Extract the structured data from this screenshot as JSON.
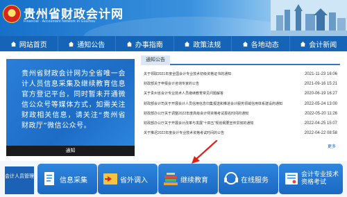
{
  "header": {
    "title": "贵州省财政会计网",
    "subtitle": "Financial · Accountant Network In GuiZhou"
  },
  "nav": [
    {
      "label": "网站首页",
      "icon": "home-icon"
    },
    {
      "label": "通知公告",
      "icon": "home-icon"
    },
    {
      "label": "办事指南",
      "icon": "home-icon"
    },
    {
      "label": "政策法规",
      "icon": "home-icon"
    },
    {
      "label": "各地动态",
      "icon": "home-icon"
    },
    {
      "label": "会计新闻",
      "icon": "home-icon"
    }
  ],
  "banner": {
    "text": "贵州省财政会计网为全省唯一会计人员信息采集及继续教育信息官方登记平台，同时暂未开通微信公众号等媒体方式，如需关注财政相关信息，请关注“贵州省财政厅”微信公众号。",
    "caption": "通知"
  },
  "notices": {
    "tab": "通知公告",
    "more": "更多",
    "items": [
      {
        "title": "关于领取2021年度全国会计专业技术初级资格证书的通知",
        "date": "2021-11-23 16:06"
      },
      {
        "title": "财政部关于申报会计咨询专家的公告",
        "date": "2021-09-16 15:21"
      },
      {
        "title": "关于贵州省会计专业技术人员继续教育常见问题解答",
        "date": "2020-06-19 16:27"
      },
      {
        "title": "财政部会计司关于开展会计人员信用信息归集报送和推进会计服务领域信用体系建设的通知",
        "date": "2022-05-24 13:00"
      },
      {
        "title": "财政部办公厅关于调整2022年度高级会计师资格考试报名时间的通知",
        "date": "2022-05-20 11:26"
      },
      {
        "title": "财政部办公厅关于开展会计改革与发展“十四五”规划纲要宣传贯彻的通知",
        "date": "2022-04-25 15:07"
      },
      {
        "title": "关于推迟2022年度会计专业技术资格考试时间的公告",
        "date": "2022-04-22 08:58"
      }
    ]
  },
  "quick": {
    "label": "会计人员管理",
    "buttons": [
      {
        "label": "信息采集",
        "icon": "document-icon"
      },
      {
        "label": "省外调入",
        "icon": "transfer-icon"
      },
      {
        "label": "继续教育",
        "icon": "books-icon"
      },
      {
        "label": "在线服务",
        "icon": "headset-icon"
      },
      {
        "label": "会计专业技术资格考试",
        "icon": "certificate-icon"
      }
    ]
  },
  "colors": {
    "brand": "#1664b8",
    "accent_arrow": "#e0201a"
  }
}
